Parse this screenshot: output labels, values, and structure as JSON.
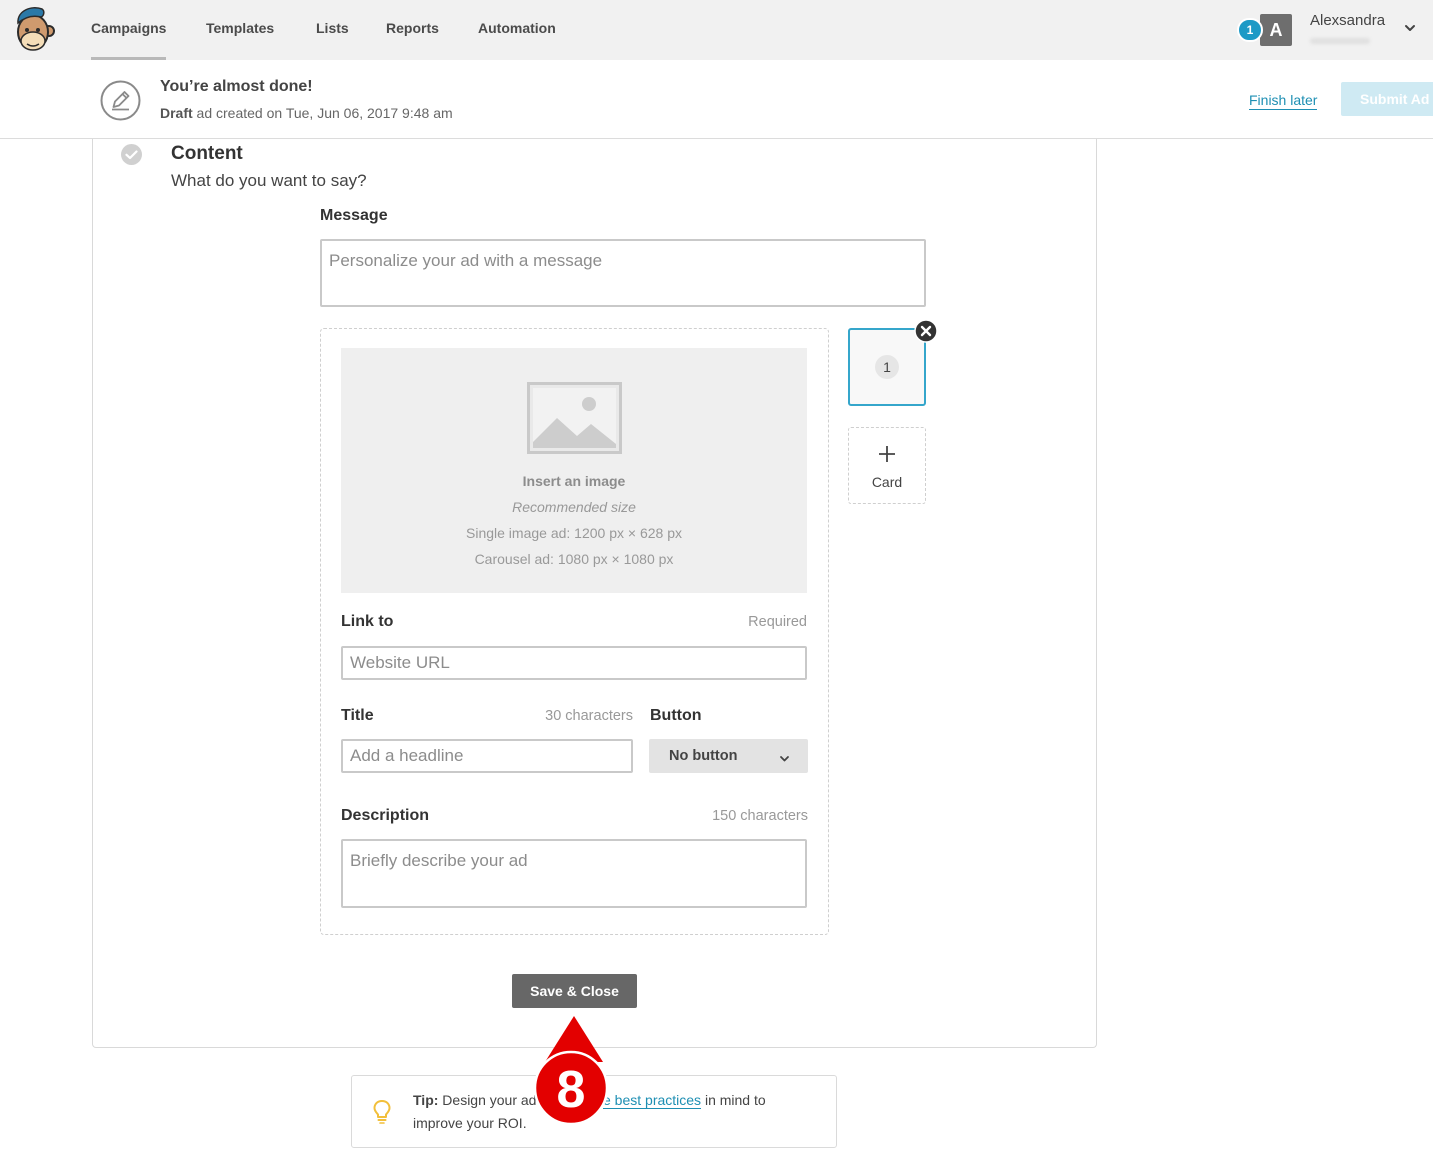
{
  "nav": {
    "items": [
      {
        "label": "Campaigns",
        "active": true
      },
      {
        "label": "Templates",
        "active": false
      },
      {
        "label": "Lists",
        "active": false
      },
      {
        "label": "Reports",
        "active": false
      },
      {
        "label": "Automation",
        "active": false
      }
    ],
    "notification_count": "1",
    "avatar_initial": "A",
    "user_name": "Alexsandra"
  },
  "header": {
    "title": "You’re almost done!",
    "status_bold": "Draft",
    "status_text": " ad created on Tue, Jun 06, 2017 9:48 am",
    "finish_later": "Finish later",
    "submit": "Submit Ad"
  },
  "content": {
    "heading": "Content",
    "subheading": "What do you want to say?",
    "message": {
      "label": "Message",
      "placeholder": "Personalize your ad with a message"
    },
    "image": {
      "title": "Insert an image",
      "recommended": "Recommended size",
      "single": "Single image ad: 1200 px × 628 px",
      "carousel": "Carousel ad: 1080 px × 1080 px"
    },
    "link": {
      "label": "Link to",
      "hint": "Required",
      "placeholder": "Website URL"
    },
    "title": {
      "label": "Title",
      "hint": "30 characters",
      "placeholder": "Add a headline"
    },
    "button": {
      "label": "Button",
      "value": "No button"
    },
    "description": {
      "label": "Description",
      "hint": "150 characters",
      "placeholder": "Briefly describe your ad"
    },
    "cards": [
      {
        "number": "1",
        "selected": true
      }
    ],
    "add_card_label": "Card",
    "save_close": "Save & Close"
  },
  "tip": {
    "label": "Tip:",
    "text_before": " Design your ad",
    "link": "e best practices",
    "text_after": " in mind to",
    "line2": "improve your ROI."
  },
  "annotation": {
    "step": "8"
  },
  "icons": {
    "logo": "mailchimp-logo-icon",
    "user_menu": "chevron-down-icon",
    "header": "pencil-icon",
    "section_status": "check-circle-icon",
    "image_placeholder": "image-icon",
    "remove_card": "close-icon",
    "add_card": "plus-icon",
    "button_select": "chevron-down-icon",
    "tip": "lightbulb-icon"
  },
  "colors": {
    "accent": "#1e8fb3",
    "badge": "#1d9ac6",
    "submit_disabled": "#cfeaf3",
    "save_button": "#676767",
    "selected_card_border": "#35a6cb",
    "annotation": "#e30000",
    "tip_icon": "#f2bf3a"
  }
}
